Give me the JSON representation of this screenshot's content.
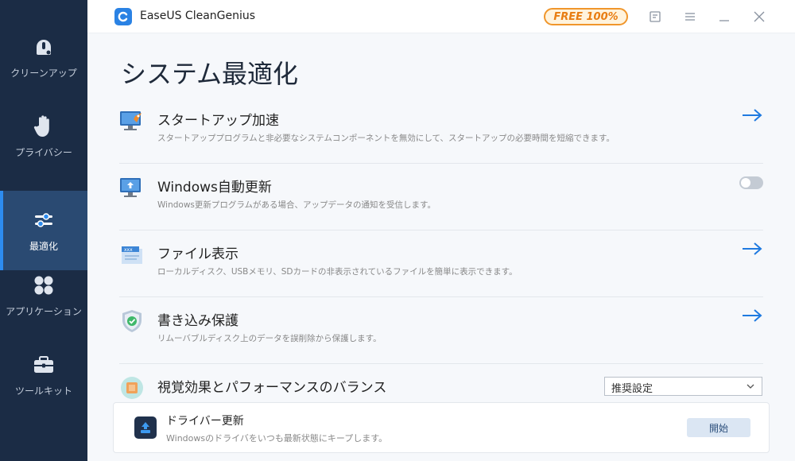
{
  "app": {
    "title": "EaseUS CleanGenius",
    "badge": "FREE 100%"
  },
  "sidebar": {
    "items": [
      {
        "label": "クリーンアップ",
        "icon": "broom-icon",
        "active": false
      },
      {
        "label": "プライバシー",
        "icon": "hand-icon",
        "active": false
      },
      {
        "label": "最適化",
        "icon": "sliders-icon",
        "active": true
      },
      {
        "label": "アプリケーション",
        "icon": "apps-icon",
        "active": false
      },
      {
        "label": "ツールキット",
        "icon": "toolbox-icon",
        "active": false
      }
    ]
  },
  "main": {
    "title": "システム最適化",
    "rows": [
      {
        "title": "スタートアップ加速",
        "desc": "スタートアッププログラムと非必要なシステムコンポーネントを無効にして、スタートアップの必要時間を短縮できます。",
        "action": "arrow",
        "icon": "startup-rocket-icon"
      },
      {
        "title": "Windows自動更新",
        "desc": "Windows更新プログラムがある場合、アップデータの通知を受信します。",
        "action": "toggle",
        "icon": "windows-update-icon"
      },
      {
        "title": "ファイル表示",
        "desc": "ローカルディスク、USBメモリ、SDカードの非表示されているファイルを簡単に表示できます。",
        "action": "arrow",
        "icon": "hidden-file-icon"
      },
      {
        "title": "書き込み保護",
        "desc": "リムーバブルディスク上のデータを誤削除から保護します。",
        "action": "arrow",
        "icon": "shield-check-icon"
      },
      {
        "title": "視覚効果とパフォーマンスのバランス",
        "desc": "",
        "action": "select",
        "icon": "performance-chip-icon"
      }
    ],
    "select_value": "推奨設定"
  },
  "card": {
    "title": "ドライバー更新",
    "desc": "Windowsのドライバをいつも最新状態にキープします。",
    "button": "開始"
  },
  "colors": {
    "sidebar": "#1b2c45",
    "active": "#2a4a72",
    "accent": "#2d8cf0",
    "badge": "#f0962b"
  }
}
